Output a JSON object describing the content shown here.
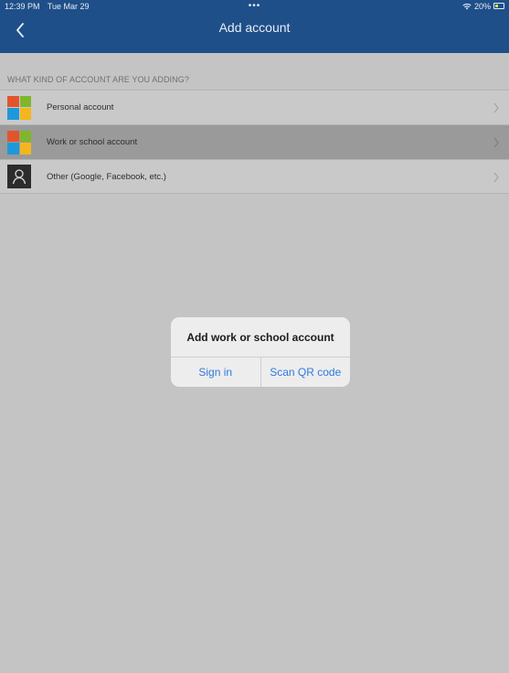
{
  "status_bar": {
    "time": "12:39 PM",
    "date": "Tue Mar 29",
    "dots": "•••",
    "battery": "20%"
  },
  "nav": {
    "title": "Add account"
  },
  "section": {
    "header": "WHAT KIND OF ACCOUNT ARE YOU ADDING?"
  },
  "accounts": [
    {
      "label": "Personal account",
      "icon": "microsoft-logo"
    },
    {
      "label": "Work or school account",
      "icon": "microsoft-logo",
      "selected": true
    },
    {
      "label": "Other (Google, Facebook, etc.)",
      "icon": "person-icon"
    }
  ],
  "dialog": {
    "title": "Add work or school account",
    "sign_in": "Sign in",
    "scan_qr": "Scan QR code"
  },
  "colors": {
    "nav_blue": "#1f4f88",
    "link_blue": "#2f7ae0",
    "overlay_gray": "#c4c4c4"
  }
}
